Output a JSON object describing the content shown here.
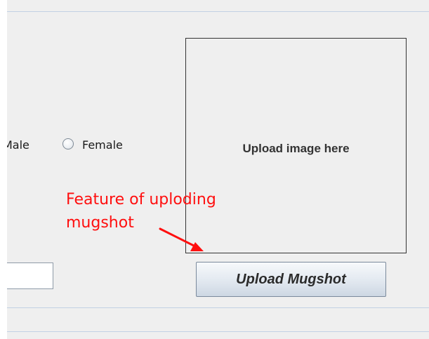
{
  "form": {
    "gender": {
      "male_label": "Male",
      "female_label": "Female"
    },
    "text_field": {
      "value": ""
    },
    "image_area": {
      "placeholder": "Upload image here"
    },
    "upload_button": {
      "label": "Upload Mugshot"
    }
  },
  "annotation": {
    "lines": [
      "Feature of uploding",
      "mugshot"
    ],
    "color": "#ff0f0f"
  },
  "colors": {
    "panel_background": "#efefef",
    "divider": "#c2d1e4",
    "button_gradient_top": "#f7f9fb",
    "button_gradient_bottom": "#cdd7e3"
  }
}
